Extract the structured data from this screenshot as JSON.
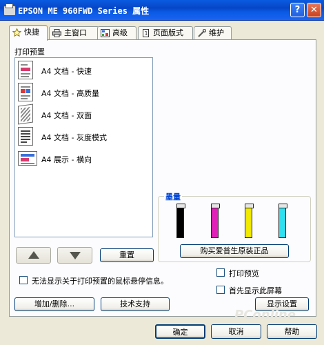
{
  "window": {
    "title": "EPSON ME 960FWD Series 属性",
    "help_symbol": "?",
    "close_symbol": "✕"
  },
  "tabs": [
    {
      "label": "快捷",
      "icon": "star-icon"
    },
    {
      "label": "主窗口",
      "icon": "printer-icon"
    },
    {
      "label": "高级",
      "icon": "settings-icon"
    },
    {
      "label": "页面版式",
      "icon": "page-layout-icon"
    },
    {
      "label": "维护",
      "icon": "wrench-icon"
    }
  ],
  "presets": {
    "label": "打印预置",
    "items": [
      {
        "label": "A4 文档 - 快速"
      },
      {
        "label": "A4 文档 - 高质量"
      },
      {
        "label": "A4 文档 - 双面"
      },
      {
        "label": "A4 文档 - 灰度模式"
      },
      {
        "label": "A4 展示 - 横向"
      }
    ],
    "reset_label": "重置",
    "no_tooltip_label": "无法显示关于打印预置的鼠标悬停信息。",
    "add_remove_label": "增加/删除...",
    "tech_support_label": "技术支持"
  },
  "ink": {
    "title": "墨量",
    "levels": [
      {
        "color": "#000000",
        "level": 1.0
      },
      {
        "color": "#e020b8",
        "level": 1.0
      },
      {
        "color": "#f2ea00",
        "level": 1.0
      },
      {
        "color": "#2ee0f0",
        "level": 1.0
      }
    ],
    "buy_label": "购买爱普生原装正品"
  },
  "options": {
    "print_preview_label": "打印预览",
    "show_first_label": "首先显示此屏幕",
    "display_settings_label": "显示设置"
  },
  "footer": {
    "ok_label": "确定",
    "cancel_label": "取消",
    "help_label": "帮助"
  },
  "watermark": "PConline"
}
